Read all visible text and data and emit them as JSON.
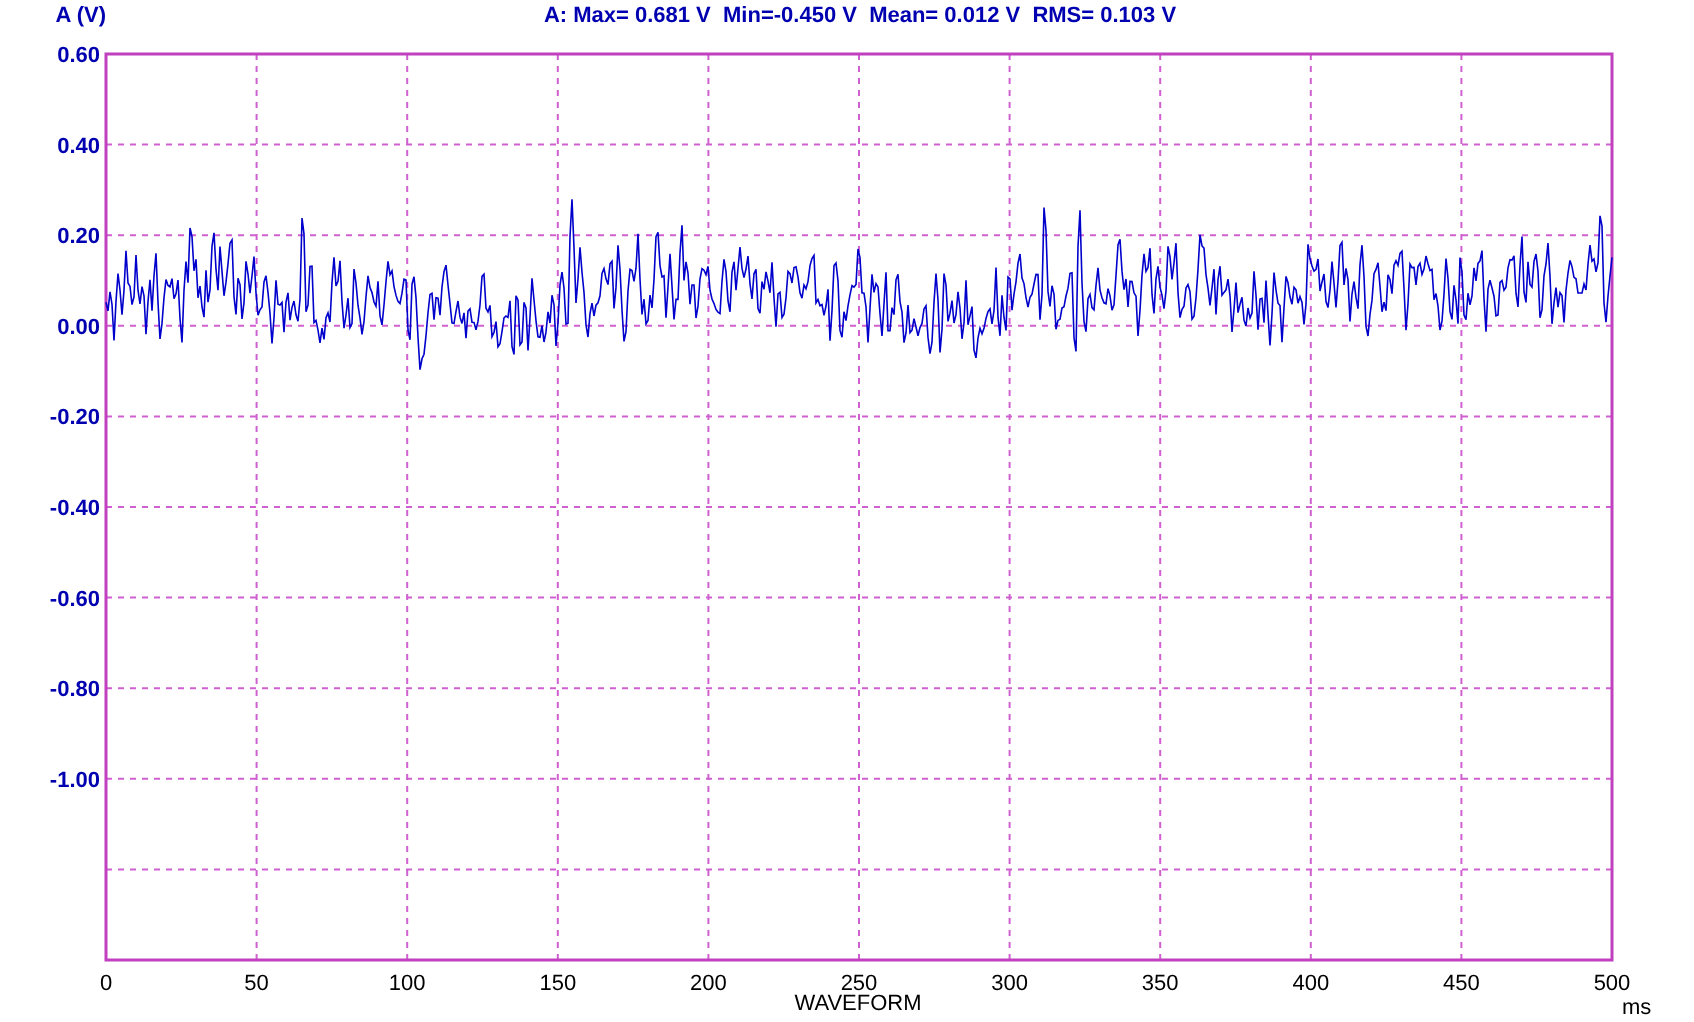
{
  "plot": {
    "y_unit": "A (V)",
    "stats": "A: Max= 0.681 V  Min=-0.450 V  Mean= 0.012 V  RMS= 0.103 V",
    "y_labels": [
      "0.60",
      "0.40",
      "0.20",
      "0.00",
      "-0.20",
      "-0.40",
      "-0.60",
      "-0.80",
      "-1.00"
    ],
    "x_labels": [
      "0",
      "50",
      "100",
      "150",
      "200",
      "250",
      "300",
      "350",
      "400",
      "450",
      "500"
    ],
    "x_unit": "ms",
    "x_title": "WAVEFORM"
  }
}
